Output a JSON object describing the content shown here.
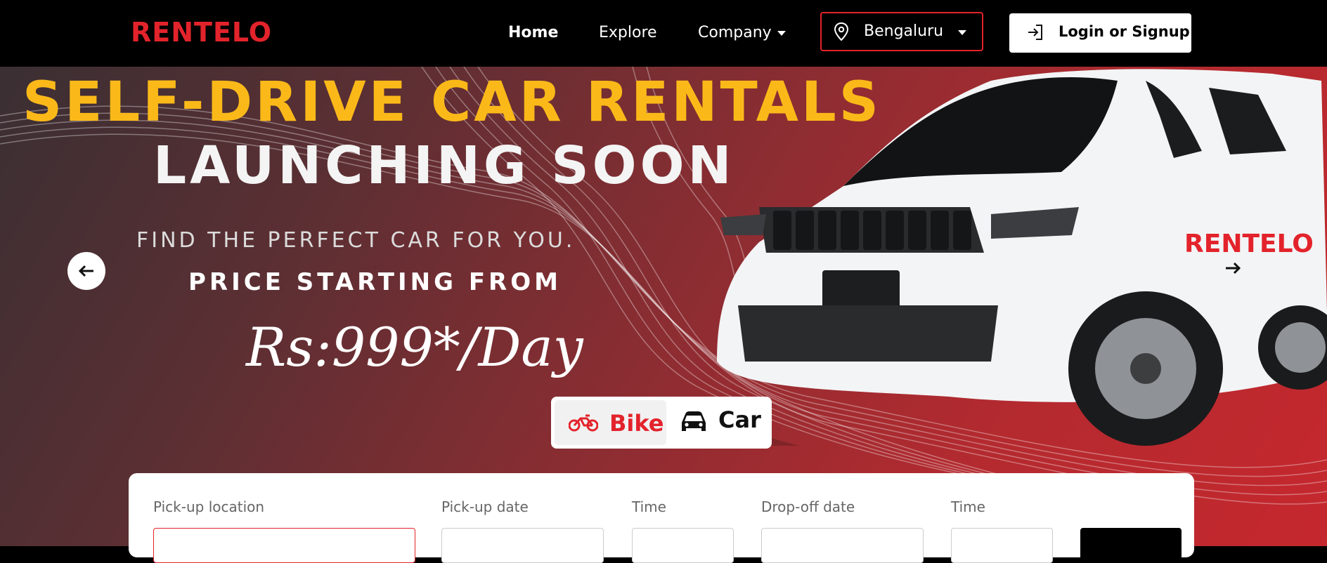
{
  "nav": {
    "logo": "RENTELO",
    "links": [
      "Home",
      "Explore",
      "Company"
    ],
    "city": "Bengaluru",
    "login": "Login or Signup"
  },
  "hero": {
    "line1": "SELF-DRIVE CAR RENTALS",
    "line2": "LAUNCHING SOON",
    "line3": "FIND THE PERFECT CAR FOR YOU.",
    "line4": "PRICE STARTING FROM",
    "line5": "Rs:999*/Day",
    "car_brand": "RENTELO"
  },
  "vehicle_toggle": {
    "bike": "Bike",
    "car": "Car"
  },
  "search_form": {
    "pickup_location": "Pick-up location",
    "pickup_date": "Pick-up date",
    "pickup_time": "Time",
    "dropoff_date": "Drop-off date",
    "dropoff_time": "Time"
  },
  "colors": {
    "brand_red": "#e3232b",
    "headline_yellow": "#fbb919",
    "nav_bg": "#000000"
  },
  "icons": [
    "map-pin-icon",
    "login-icon",
    "chevron-down-icon",
    "arrow-left-icon",
    "arrow-right-icon",
    "motorcycle-icon",
    "car-icon"
  ]
}
